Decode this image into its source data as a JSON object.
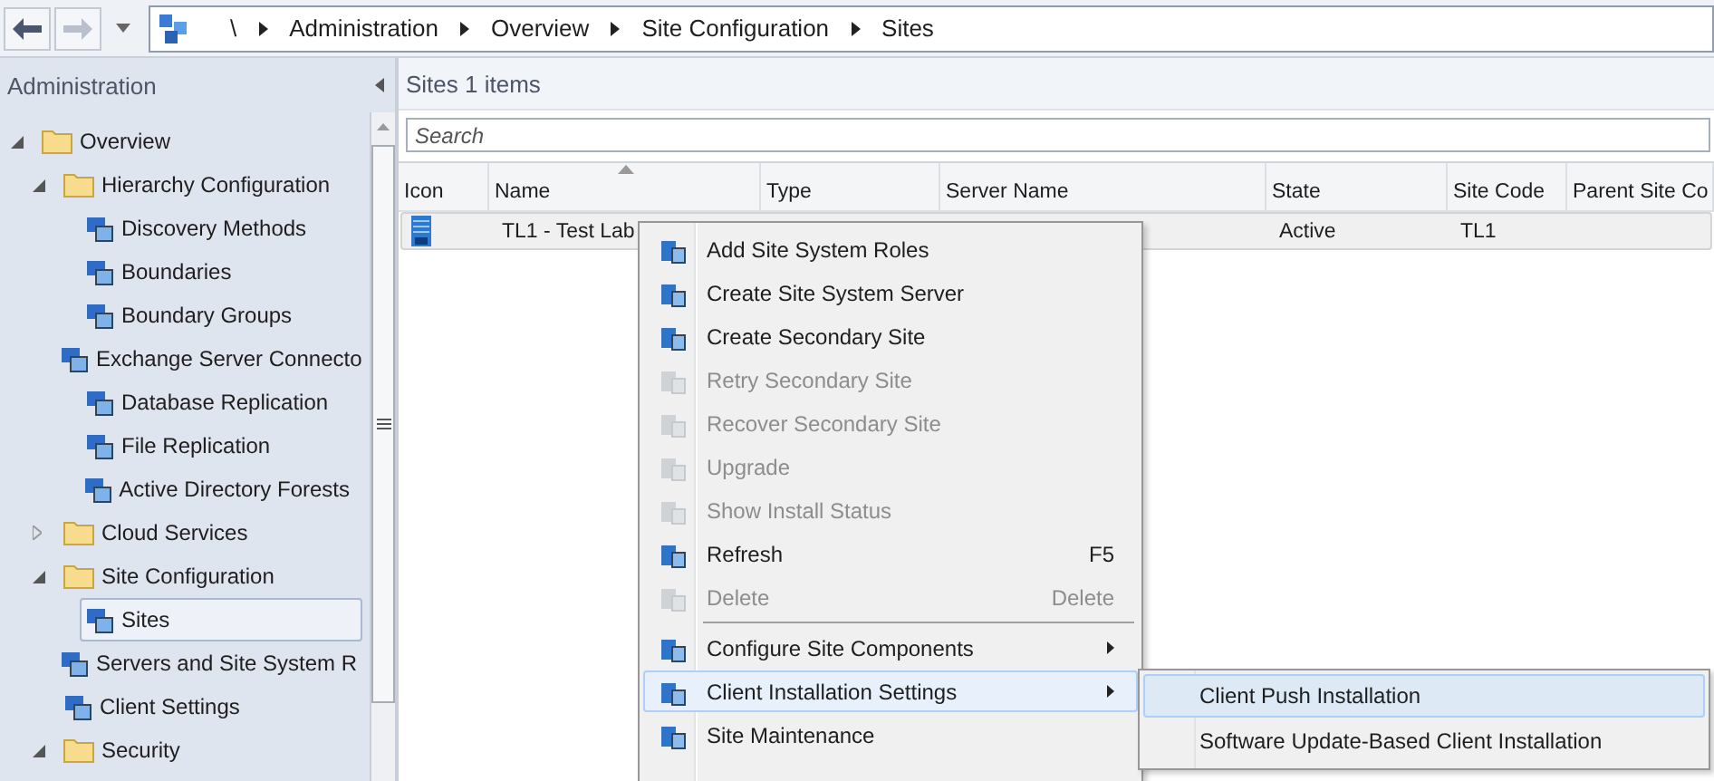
{
  "breadcrumb": [
    "\\",
    "Administration",
    "Overview",
    "Site Configuration",
    "Sites"
  ],
  "nav_pane": {
    "title": "Administration",
    "tree": [
      {
        "label": "Overview",
        "expanded": true,
        "selected": false,
        "children": [
          {
            "label": "Hierarchy Configuration",
            "expanded": true,
            "selected": false,
            "children": [
              {
                "label": "Discovery Methods",
                "selected": false
              },
              {
                "label": "Boundaries",
                "selected": false
              },
              {
                "label": "Boundary Groups",
                "selected": false
              },
              {
                "label": "Exchange Server Connecto",
                "selected": false
              },
              {
                "label": "Database Replication",
                "selected": false
              },
              {
                "label": "File Replication",
                "selected": false
              },
              {
                "label": "Active Directory Forests",
                "selected": false
              }
            ]
          },
          {
            "label": "Cloud Services",
            "expanded": false,
            "selected": false
          },
          {
            "label": "Site Configuration",
            "expanded": true,
            "selected": false,
            "children": [
              {
                "label": "Sites",
                "selected": true
              },
              {
                "label": "Servers and Site System R",
                "selected": false
              }
            ]
          },
          {
            "label": "Client Settings",
            "selected": false
          },
          {
            "label": "Security",
            "expanded": true,
            "selected": false
          }
        ]
      }
    ]
  },
  "list": {
    "title": "Sites 1 items",
    "search": {
      "placeholder": "Search"
    },
    "columns": [
      {
        "label": "Icon",
        "sorted": false
      },
      {
        "label": "Name",
        "sorted": true
      },
      {
        "label": "Type",
        "sorted": false
      },
      {
        "label": "Server Name",
        "sorted": false
      },
      {
        "label": "State",
        "sorted": false
      },
      {
        "label": "Site Code",
        "sorted": false
      },
      {
        "label": "Parent Site Co",
        "sorted": false
      }
    ],
    "rows": [
      {
        "name": "TL1 - Test Lab",
        "state": "Active",
        "site_code": "TL1",
        "selected": true
      }
    ]
  },
  "context_menu": [
    {
      "kind": "item",
      "label": "Add Site System Roles",
      "disabled": false,
      "highlighted": false
    },
    {
      "kind": "item",
      "label": "Create Site System Server",
      "disabled": false,
      "highlighted": false
    },
    {
      "kind": "item",
      "label": "Create Secondary Site",
      "disabled": false,
      "highlighted": false
    },
    {
      "kind": "item",
      "label": "Retry Secondary Site",
      "disabled": true,
      "highlighted": false
    },
    {
      "kind": "item",
      "label": "Recover Secondary Site",
      "disabled": true,
      "highlighted": false
    },
    {
      "kind": "item",
      "label": "Upgrade",
      "disabled": true,
      "highlighted": false
    },
    {
      "kind": "item",
      "label": "Show Install Status",
      "disabled": true,
      "highlighted": false
    },
    {
      "kind": "item",
      "label": "Refresh",
      "shortcut": "F5",
      "disabled": false,
      "highlighted": false
    },
    {
      "kind": "item",
      "label": "Delete",
      "shortcut": "Delete",
      "disabled": true,
      "highlighted": false
    },
    {
      "kind": "separator"
    },
    {
      "kind": "item",
      "label": "Configure Site Components",
      "submenu": true,
      "disabled": false,
      "highlighted": false
    },
    {
      "kind": "item",
      "label": "Client Installation Settings",
      "submenu": true,
      "disabled": false,
      "highlighted": true
    },
    {
      "kind": "item",
      "label": "Site Maintenance",
      "disabled": false,
      "highlighted": false
    }
  ],
  "submenu": [
    {
      "label": "Client Push Installation",
      "highlighted": true
    },
    {
      "label": "Software Update-Based Client Installation",
      "highlighted": false
    }
  ]
}
